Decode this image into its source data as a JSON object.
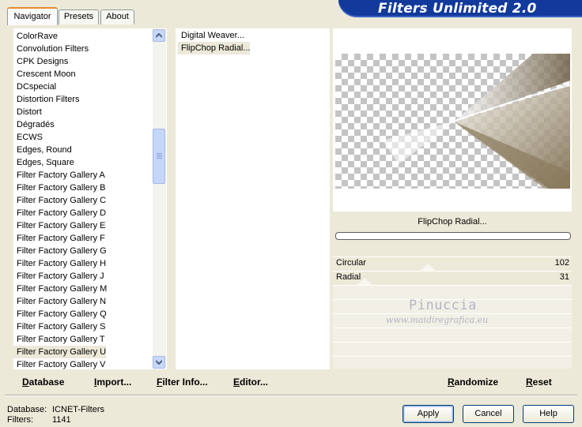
{
  "tabs": [
    {
      "label": "Navigator",
      "active": true
    },
    {
      "label": "Presets",
      "active": false
    },
    {
      "label": "About",
      "active": false
    }
  ],
  "banner": {
    "title": "Filters Unlimited 2.0",
    "color": "#123a9c"
  },
  "categories": {
    "items": [
      "ColorRave",
      "Convolution Filters",
      "CPK Designs",
      "Crescent Moon",
      "DCspecial",
      "Distortion Filters",
      "Distort",
      "Dégradés",
      "ECWS",
      "Edges, Round",
      "Edges, Square",
      "Filter Factory Gallery A",
      "Filter Factory Gallery B",
      "Filter Factory Gallery C",
      "Filter Factory Gallery D",
      "Filter Factory Gallery E",
      "Filter Factory Gallery F",
      "Filter Factory Gallery G",
      "Filter Factory Gallery H",
      "Filter Factory Gallery J",
      "Filter Factory Gallery M",
      "Filter Factory Gallery N",
      "Filter Factory Gallery Q",
      "Filter Factory Gallery S",
      "Filter Factory Gallery T",
      "Filter Factory Gallery U",
      "Filter Factory Gallery V"
    ],
    "selected": "Filter Factory Gallery U"
  },
  "filters": {
    "items": [
      "Digital Weaver...",
      "FlipChop Radial..."
    ],
    "selected": "FlipChop Radial..."
  },
  "preview": {
    "filter_name": "FlipChop Radial...",
    "progress": 0
  },
  "sliders": [
    {
      "label": "Circular",
      "value": "102"
    },
    {
      "label": "Radial",
      "value": "31"
    }
  ],
  "watermark": {
    "line1": "Pinuccia",
    "line2": "www.maidiregrafica.eu"
  },
  "toolbar": {
    "database": "Database",
    "import": "Import...",
    "filter_info": "Filter Info...",
    "editor": "Editor...",
    "randomize": "Randomize",
    "reset": "Reset"
  },
  "status": {
    "database_label": "Database:",
    "database_value": "ICNET-Filters",
    "filters_label": "Filters:",
    "filters_value": "1141"
  },
  "buttons": {
    "apply": "Apply",
    "cancel": "Cancel",
    "help": "Help"
  }
}
